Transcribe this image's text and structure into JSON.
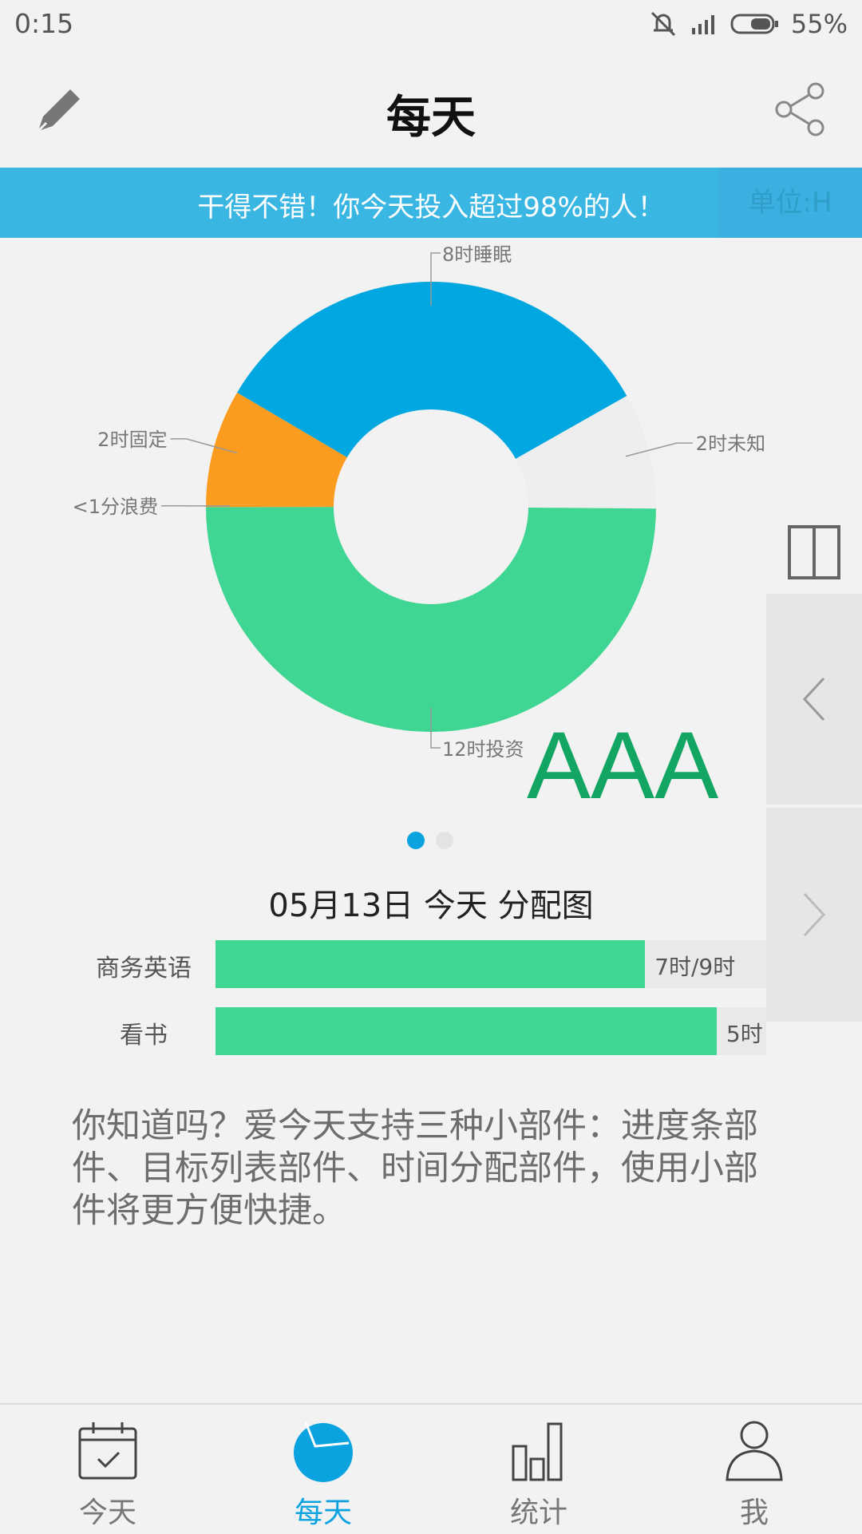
{
  "status_bar": {
    "time": "0:15",
    "battery": "55%"
  },
  "header": {
    "title": "每天"
  },
  "banner": {
    "text": "干得不错！你今天投入超过98%的人！",
    "unit": "单位:H"
  },
  "chart_data": {
    "type": "pie",
    "donut": true,
    "categories": [
      "12时投资",
      "<1分浪费",
      "2时固定",
      "8时睡眠",
      "2时未知"
    ],
    "values": [
      12,
      0.01,
      2,
      8,
      2
    ],
    "colors": [
      "#3fd592",
      "#f59a1f",
      "#fb9c1f",
      "#00a7e1",
      "#eeeeee"
    ],
    "labels": [
      "12时投资",
      "<1分浪费",
      "2时固定",
      "8时睡眠",
      "2时未知"
    ]
  },
  "overlay_text": "AAA",
  "pager": {
    "count": 2,
    "active": 0
  },
  "allocation": {
    "title": "05月13日 今天 分配图",
    "items": [
      {
        "label": "商务英语",
        "value": "7时/9时",
        "fraction": 0.78
      },
      {
        "label": "看书",
        "value": "5时",
        "fraction": 0.91
      }
    ]
  },
  "tip": "你知道吗？爱今天支持三种小部件：进度条部件、目标列表部件、时间分配部件，使用小部件将更方便快捷。",
  "tabs": [
    {
      "label": "今天",
      "icon": "calendar-icon"
    },
    {
      "label": "每天",
      "icon": "pie-chart-icon",
      "active": true
    },
    {
      "label": "统计",
      "icon": "bar-chart-icon"
    },
    {
      "label": "我",
      "icon": "user-icon"
    }
  ]
}
